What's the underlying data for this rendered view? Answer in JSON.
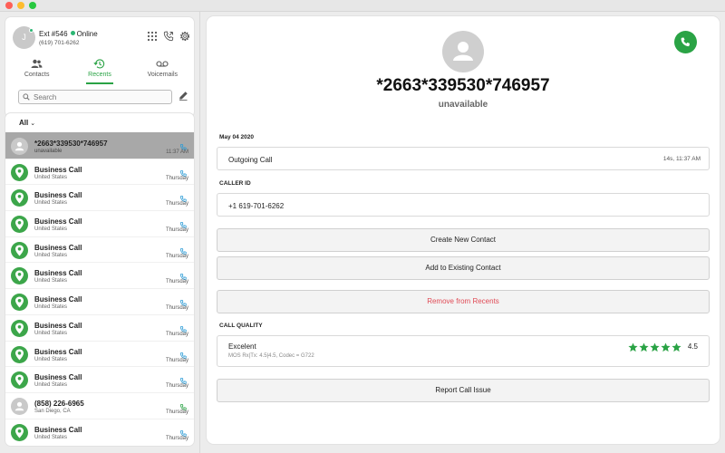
{
  "colors": {
    "accent": "#2aa345",
    "online": "#2bb673",
    "danger": "#e04a55",
    "selected_row": "#a8a8a8"
  },
  "account": {
    "avatar_initial": "J",
    "ext": "Ext #546",
    "status": "Online",
    "phone": "(619) 701-6262",
    "icons": [
      "dialpad-icon",
      "phone-call-icon",
      "gear-icon"
    ]
  },
  "tabs": [
    {
      "label": "Contacts",
      "icon": "contacts-icon"
    },
    {
      "label": "Recents",
      "icon": "history-icon",
      "active": true
    },
    {
      "label": "Voicemails",
      "icon": "voicemail-icon"
    }
  ],
  "search": {
    "placeholder": "Search",
    "value": ""
  },
  "filter": {
    "label": "All"
  },
  "recents": [
    {
      "name": "*2663*339530*746957",
      "sub": "unavailable",
      "time": "11:37 AM",
      "type": "unknown",
      "selected": true
    },
    {
      "name": "Business Call",
      "sub": "United States",
      "time": "Thursday",
      "type": "business"
    },
    {
      "name": "Business Call",
      "sub": "United States",
      "time": "Thursday",
      "type": "business"
    },
    {
      "name": "Business Call",
      "sub": "United States",
      "time": "Thursday",
      "type": "business"
    },
    {
      "name": "Business Call",
      "sub": "United States",
      "time": "Thursday",
      "type": "business"
    },
    {
      "name": "Business Call",
      "sub": "United States",
      "time": "Thursday",
      "type": "business"
    },
    {
      "name": "Business Call",
      "sub": "United States",
      "time": "Thursday",
      "type": "business"
    },
    {
      "name": "Business Call",
      "sub": "United States",
      "time": "Thursday",
      "type": "business"
    },
    {
      "name": "Business Call",
      "sub": "United States",
      "time": "Thursday",
      "type": "business"
    },
    {
      "name": "Business Call",
      "sub": "United States",
      "time": "Thursday",
      "type": "business"
    },
    {
      "name": "(858) 226-6965",
      "sub": "San Diego, CA",
      "time": "Thursday",
      "type": "unknown"
    },
    {
      "name": "Business Call",
      "sub": "United States",
      "time": "Thursday",
      "type": "business"
    }
  ],
  "detail": {
    "number": "*2663*339530*746957",
    "status": "unavailable",
    "date": "May 04 2020",
    "call_type": "Outgoing Call",
    "call_info": "14s, 11:37 AM",
    "caller_id_label": "CALLER ID",
    "caller_id": "+1 619-701-6262",
    "create_contact": "Create New Contact",
    "add_existing": "Add to Existing Contact",
    "remove": "Remove from Recents",
    "quality_label": "CALL QUALITY",
    "quality": "Excelent",
    "quality_details": "MOS Rx|Tx: 4.5|4.5, Codec = G722",
    "score": "4.5",
    "stars": 5,
    "report": "Report Call Issue"
  }
}
